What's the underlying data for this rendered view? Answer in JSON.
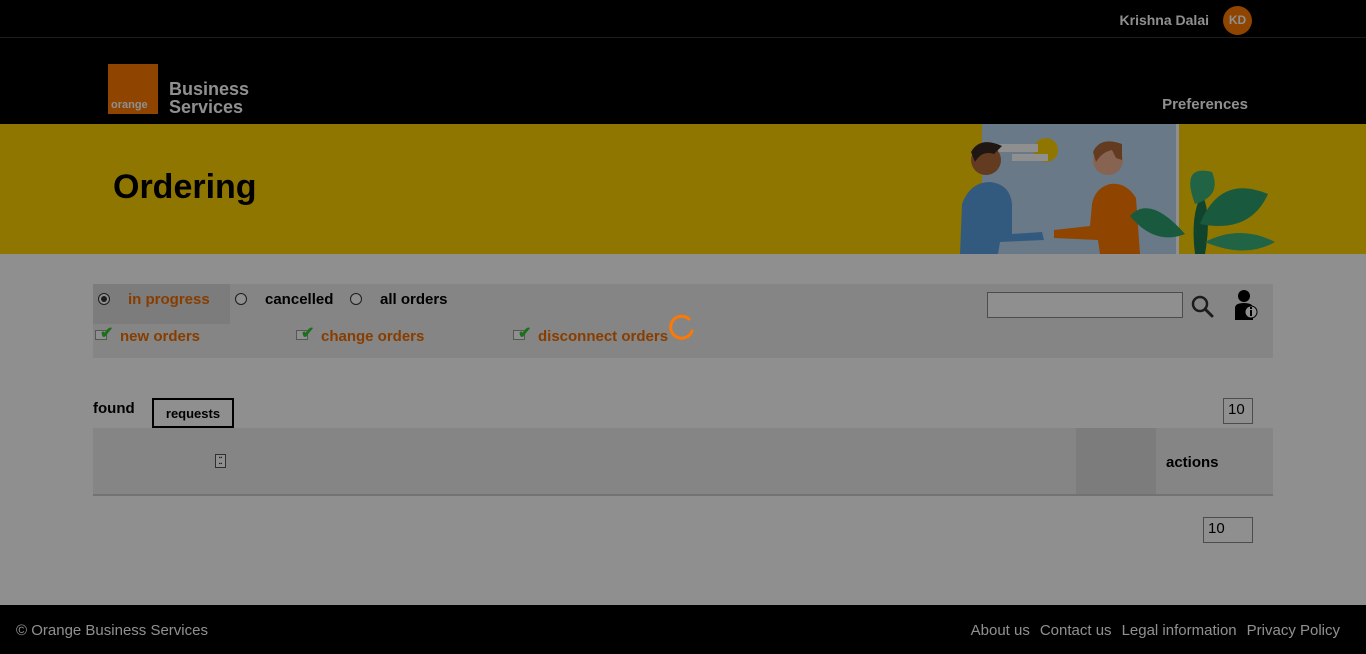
{
  "topbar": {
    "user_name": "Krishna Dalai",
    "avatar_initials": "KD"
  },
  "header": {
    "logo_text": "orange",
    "brand_line1": "Business",
    "brand_line2": "Services",
    "nav_preferences": "Preferences"
  },
  "hero": {
    "title": "Ordering"
  },
  "filters": {
    "status_options": [
      {
        "label": "in progress",
        "selected": true
      },
      {
        "label": "cancelled",
        "selected": false
      },
      {
        "label": "all orders",
        "selected": false
      }
    ],
    "type_options": [
      {
        "label": "new orders",
        "checked": true
      },
      {
        "label": "change orders",
        "checked": true
      },
      {
        "label": "disconnect orders",
        "checked": true
      }
    ],
    "search_value": ""
  },
  "results": {
    "found_label": "found",
    "requests_label": "requests",
    "page_size_top": "10",
    "page_size_bottom": "10"
  },
  "table": {
    "actions_header": "actions"
  },
  "footer": {
    "copyright": "© Orange Business Services",
    "links": [
      "About us",
      "Contact us",
      "Legal information",
      "Privacy Policy"
    ]
  },
  "colors": {
    "brand_orange": "#ff7900",
    "accent_orange": "#f16e00",
    "hero_yellow": "#ffd200",
    "check_green": "#32c832"
  },
  "icons": {
    "search": "search-icon",
    "info_user": "user-info-icon",
    "spinner": "loading-spinner-icon",
    "column": "column-settings-icon"
  }
}
